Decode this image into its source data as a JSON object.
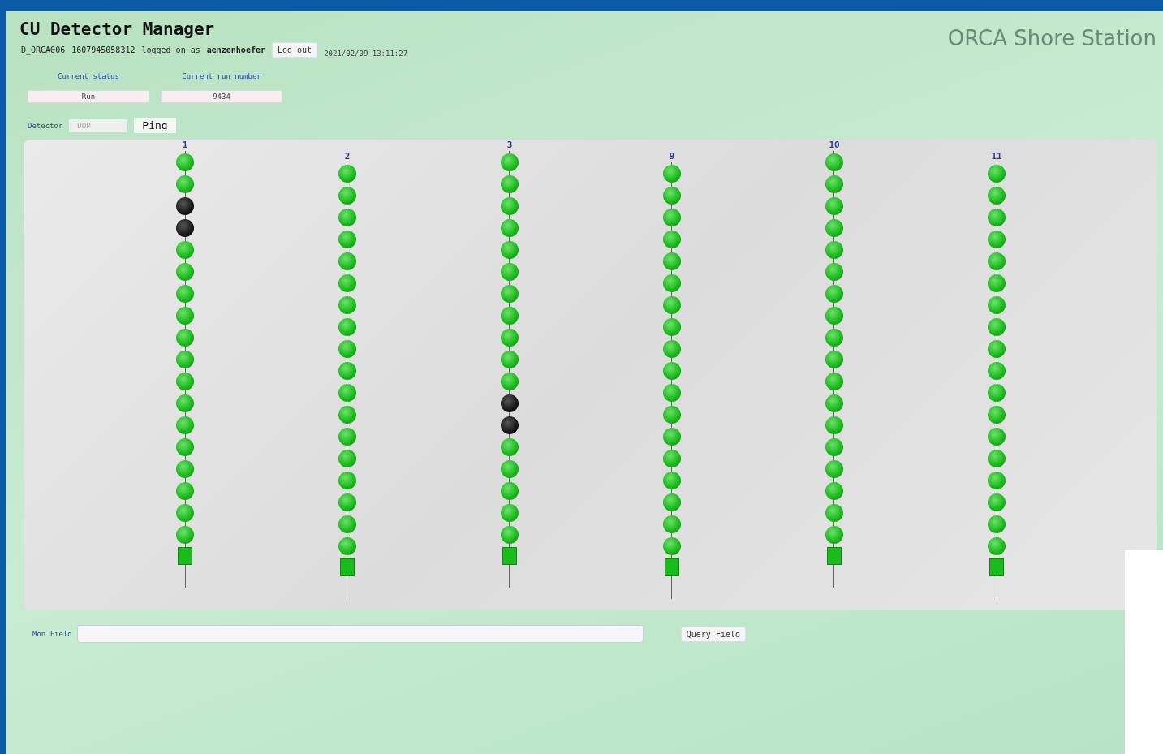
{
  "header": {
    "title": "CU Detector Manager",
    "station": "ORCA Shore Station"
  },
  "session": {
    "detector_id": "D_ORCA006",
    "token": "1607945058312",
    "logged_text": "logged on as",
    "user": "aenzenhoefer",
    "logout": "Log out",
    "timestamp": "2021/02/09-13:11:27"
  },
  "status": {
    "status_label": "Current status",
    "status_value": "Run",
    "run_label": "Current run number",
    "run_value": "9434"
  },
  "detector": {
    "label": "Detector",
    "value": "DOP",
    "disabled": true,
    "ping": "Ping"
  },
  "strings": [
    {
      "label": "1",
      "modules": [
        {
          "online": true
        },
        {
          "online": true
        },
        {
          "online": false
        },
        {
          "online": false
        },
        {
          "online": true
        },
        {
          "online": true
        },
        {
          "online": true
        },
        {
          "online": true
        },
        {
          "online": true
        },
        {
          "online": true
        },
        {
          "online": true
        },
        {
          "online": true
        },
        {
          "online": true
        },
        {
          "online": true
        },
        {
          "online": true
        },
        {
          "online": true
        },
        {
          "online": true
        },
        {
          "online": true
        }
      ]
    },
    {
      "label": "2",
      "modules": [
        {
          "online": true
        },
        {
          "online": true
        },
        {
          "online": true
        },
        {
          "online": true
        },
        {
          "online": true
        },
        {
          "online": true
        },
        {
          "online": true
        },
        {
          "online": true
        },
        {
          "online": true
        },
        {
          "online": true
        },
        {
          "online": true
        },
        {
          "online": true
        },
        {
          "online": true
        },
        {
          "online": true
        },
        {
          "online": true
        },
        {
          "online": true
        },
        {
          "online": true
        },
        {
          "online": true
        }
      ]
    },
    {
      "label": "3",
      "modules": [
        {
          "online": true
        },
        {
          "online": true
        },
        {
          "online": true
        },
        {
          "online": true
        },
        {
          "online": true
        },
        {
          "online": true
        },
        {
          "online": true
        },
        {
          "online": true
        },
        {
          "online": true
        },
        {
          "online": true
        },
        {
          "online": true
        },
        {
          "online": false
        },
        {
          "online": false
        },
        {
          "online": true
        },
        {
          "online": true
        },
        {
          "online": true
        },
        {
          "online": true
        },
        {
          "online": true
        }
      ]
    },
    {
      "label": "9",
      "modules": [
        {
          "online": true
        },
        {
          "online": true
        },
        {
          "online": true
        },
        {
          "online": true
        },
        {
          "online": true
        },
        {
          "online": true
        },
        {
          "online": true
        },
        {
          "online": true
        },
        {
          "online": true
        },
        {
          "online": true
        },
        {
          "online": true
        },
        {
          "online": true
        },
        {
          "online": true
        },
        {
          "online": true
        },
        {
          "online": true
        },
        {
          "online": true
        },
        {
          "online": true
        },
        {
          "online": true
        }
      ]
    },
    {
      "label": "10",
      "modules": [
        {
          "online": true
        },
        {
          "online": true
        },
        {
          "online": true
        },
        {
          "online": true
        },
        {
          "online": true
        },
        {
          "online": true
        },
        {
          "online": true
        },
        {
          "online": true
        },
        {
          "online": true
        },
        {
          "online": true
        },
        {
          "online": true
        },
        {
          "online": true
        },
        {
          "online": true
        },
        {
          "online": true
        },
        {
          "online": true
        },
        {
          "online": true
        },
        {
          "online": true
        },
        {
          "online": true
        }
      ]
    },
    {
      "label": "11",
      "modules": [
        {
          "online": true
        },
        {
          "online": true
        },
        {
          "online": true
        },
        {
          "online": true
        },
        {
          "online": true
        },
        {
          "online": true
        },
        {
          "online": true
        },
        {
          "online": true
        },
        {
          "online": true
        },
        {
          "online": true
        },
        {
          "online": true
        },
        {
          "online": true
        },
        {
          "online": true
        },
        {
          "online": true
        },
        {
          "online": true
        },
        {
          "online": true
        },
        {
          "online": true
        },
        {
          "online": true
        }
      ]
    }
  ],
  "monitor": {
    "label": "Mon Field",
    "button": "Query Field"
  }
}
